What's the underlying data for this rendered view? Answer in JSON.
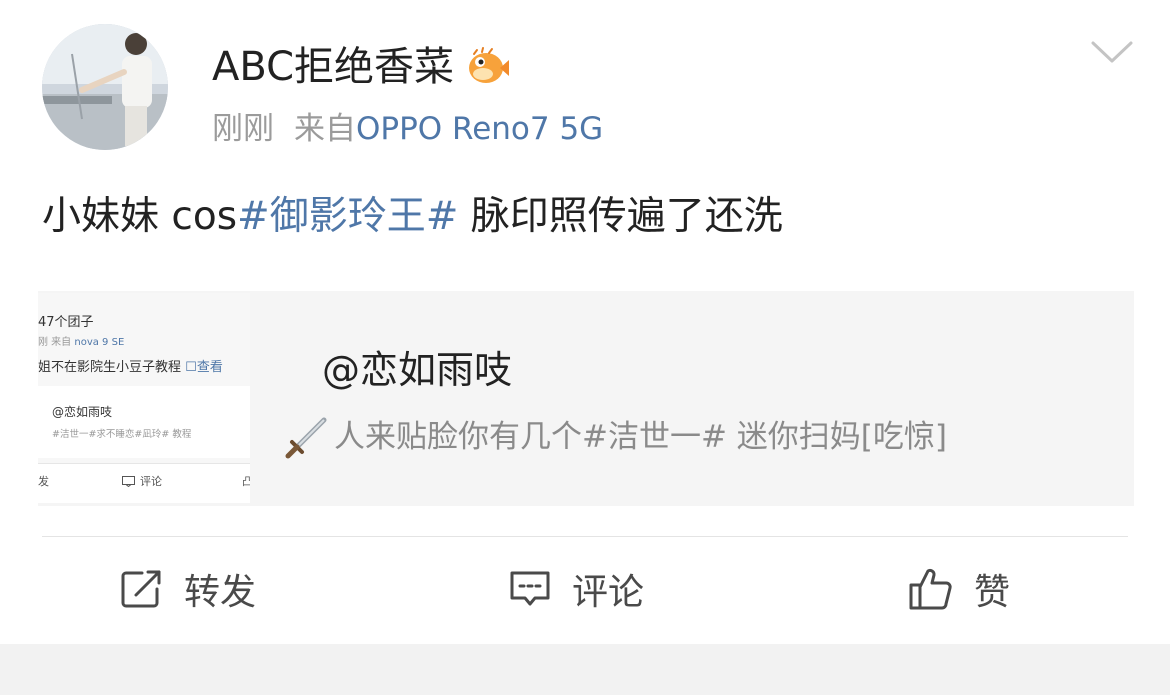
{
  "post": {
    "author": "ABC拒绝香菜",
    "time": "刚刚",
    "source_prefix": "来自",
    "device": "OPPO Reno7 5G",
    "text_before": "小妹妹 cos",
    "hashtag": "#御影玲王#",
    "text_after": " 脉印照传遍了还洗"
  },
  "quote": {
    "author": "@恋如雨吱",
    "text": "人来贴脸你有几个#洁世一# 迷你扫妈[吃惊]",
    "thumbnail": {
      "line1": "47个团子",
      "line2_prefix": "刚  来自",
      "line2_device": "nova 9 SE",
      "line3": "姐不在影院生小豆子教程",
      "line3_link": "查看",
      "inner_author": "@恋如雨吱",
      "inner_text": "#洁世一#求不睡恋#凪玲# 教程",
      "footer_left": "发",
      "footer_comment": "评论",
      "footer_right": "凸"
    }
  },
  "actions": {
    "repost": "转发",
    "comment": "评论",
    "like": "赞"
  },
  "icons": {
    "badge": "pufferfish-badge-icon",
    "menu": "chevron-down-icon",
    "repost": "share-square-icon",
    "comment": "comment-bubble-icon",
    "like": "thumbs-up-icon",
    "emoji": "sword-emoji-icon"
  },
  "colors": {
    "link": "#4f77a8",
    "text": "#222222",
    "muted": "#9b9b9b",
    "card_bg": "#f5f5f5"
  }
}
